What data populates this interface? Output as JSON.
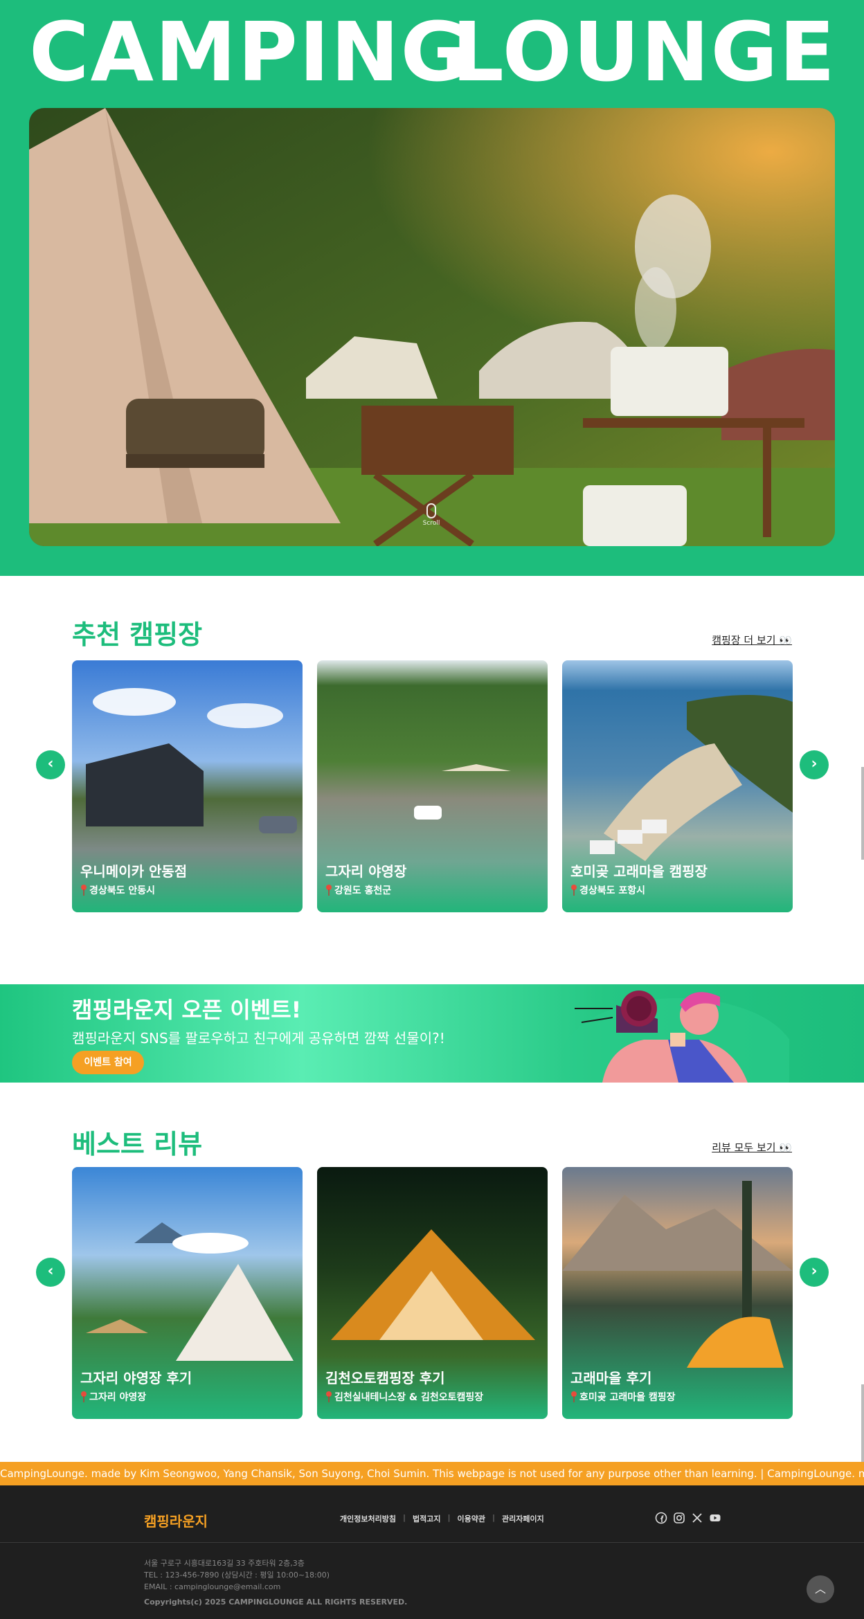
{
  "hero": {
    "title_left": "CAMPING",
    "title_right": "LOUNGE",
    "scroll_label": "Scroll"
  },
  "recommend": {
    "title": "추천 캠핑장",
    "more": "캠핑장 더 보기 👀",
    "cards": [
      {
        "name": "우니메이카 안동점",
        "location": "경상북도 안동시"
      },
      {
        "name": "그자리 야영장",
        "location": "강원도 홍천군"
      },
      {
        "name": "호미곶 고래마을 캠핑장",
        "location": "경상북도 포항시"
      }
    ]
  },
  "event": {
    "title": "캠핑라운지 오픈 이벤트!",
    "desc": "캠핑라운지 SNS를 팔로우하고 친구에게 공유하면 깜짝 선물이?!",
    "button": "이벤트 참여"
  },
  "reviews": {
    "title": "베스트 리뷰",
    "more": "리뷰 모두 보기 👀",
    "cards": [
      {
        "name": "그자리 야영장 후기",
        "location": "그자리 야영장"
      },
      {
        "name": "김천오토캠핑장 후기",
        "location": "김천실내테니스장 & 김천오토캠핑장"
      },
      {
        "name": "고래마을 후기",
        "location": "호미곶 고래마을 캠핑장"
      }
    ]
  },
  "marquee": "CampingLounge. made by Kim Seongwoo, Yang Chansik, Son Suyong, Choi Sumin. This webpage is not used for any purpose other than learning. | CampingLounge. made by Kim Seongwoo, Yang Chansik, Son Suyong, Choi Sumin.",
  "footer": {
    "brand": "캠핑라운지",
    "links": [
      "개인정보처리방침",
      "법적고지",
      "이용약관",
      "관리자페이지"
    ],
    "address": "서울 구로구 시흥대로163길 33 주호타워 2층,3층",
    "tel": "TEL : 123-456-7890 (상담시간 : 평일 10:00~18:00)",
    "email": "EMAIL : campinglounge@email.com",
    "copyright": "Copyrights(c) 2025 CAMPINGLOUNGE ALL RIGHTS RESERVED.",
    "social": [
      "facebook-icon",
      "instagram-icon",
      "x-icon",
      "youtube-icon"
    ]
  },
  "colors": {
    "brand": "#1dbd7c",
    "accent": "#f5a023",
    "footer": "#1f1f1f"
  }
}
